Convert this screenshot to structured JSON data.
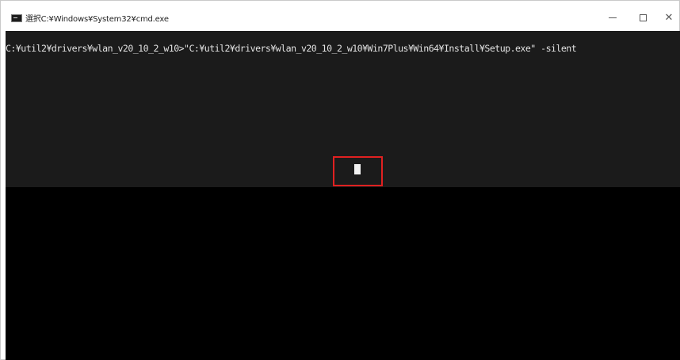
{
  "window": {
    "title": "選択C:¥Windows¥System32¥cmd.exe",
    "controls": {
      "minimize": "minimize",
      "maximize": "maximize",
      "close": "✕"
    }
  },
  "console": {
    "lines": [
      "C:¥util2¥drivers¥wlan_v20_10_2_w10>\"C:¥util2¥drivers¥wlan_v20_10_2_w10¥Win7Plus¥Win64¥Install¥Setup.exe\" -silent"
    ],
    "cursor_visible": true
  },
  "annotation": {
    "highlight_color": "#e02020"
  },
  "colors": {
    "console_background": "#000000",
    "console_upper_background": "#1b1b1b",
    "console_text": "#e2e2e2",
    "titlebar": "#ffffff"
  }
}
